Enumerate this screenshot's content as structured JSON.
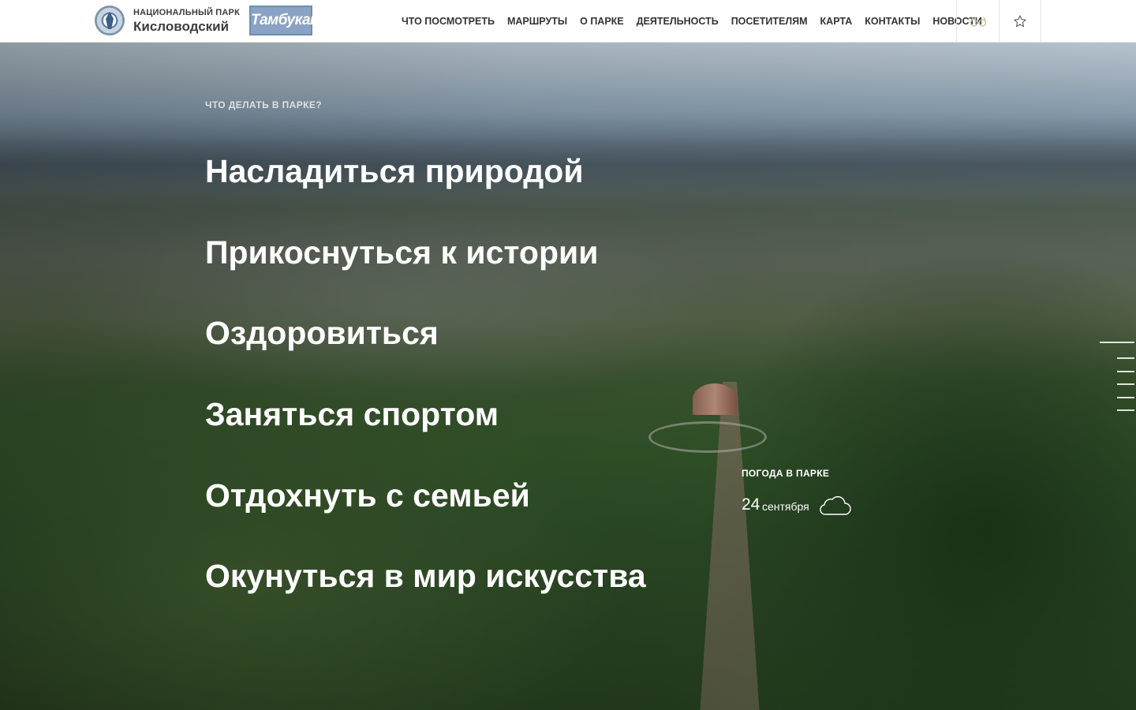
{
  "header": {
    "logo_line1": "НАЦИОНАЛЬНЫЙ ПАРК",
    "logo_line2": "Кисловодский",
    "partner_logo": "Тамбукан",
    "nav": [
      "ЧТО ПОСМОТРЕТЬ",
      "МАРШРУТЫ",
      "О ПАРКЕ",
      "ДЕЯТЕЛЬНОСТЬ",
      "ПОСЕТИТЕЛЯМ",
      "КАРТА",
      "КОНТАКТЫ",
      "НОВОСТИ"
    ],
    "icons": [
      "glasses-icon",
      "star-icon"
    ]
  },
  "hero": {
    "eyebrow": "ЧТО ДЕЛАТЬ В ПАРКЕ?",
    "activities": [
      "Насладиться природой",
      "Прикоснуться к истории",
      "Оздоровиться",
      "Заняться спортом",
      "Отдохнуть с семьей",
      "Окунуться в мир искусства"
    ]
  },
  "weather": {
    "title": "ПОГОДА В ПАРКЕ",
    "day": "24",
    "month": "сентября",
    "icon": "cloud-icon"
  },
  "slides": {
    "count": 6,
    "active": 1
  },
  "colors": {
    "header_bg": "#ffffff",
    "nav_text": "#333333",
    "hero_text": "#ffffff",
    "partner_logo_bg": "#8aa3c4"
  }
}
